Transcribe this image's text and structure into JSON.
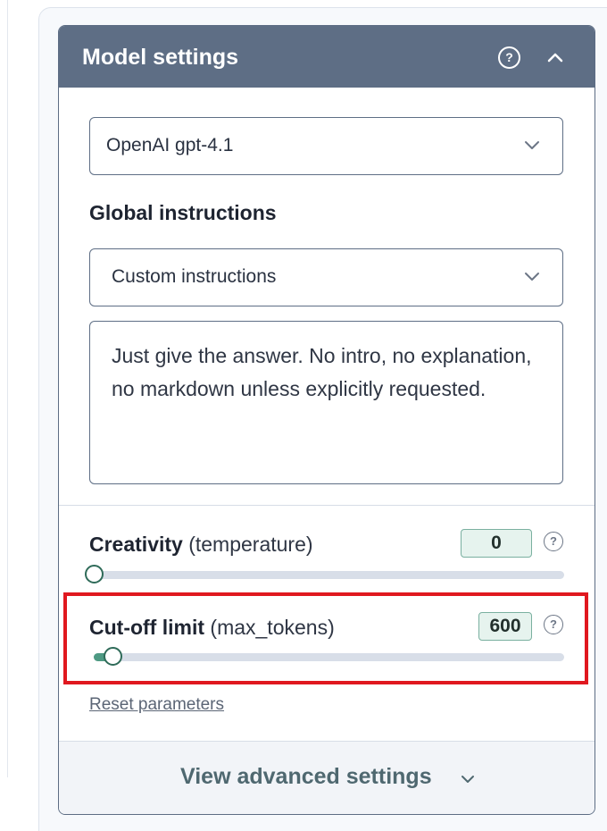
{
  "panel": {
    "title": "Model settings",
    "help_icon": "help-icon",
    "collapse_icon": "chevron-up-icon"
  },
  "model_select": {
    "value": "OpenAI gpt-4.1",
    "icon": "chevron-down-icon"
  },
  "global_instructions": {
    "label": "Global instructions",
    "select_value": "Custom instructions",
    "text": "Just give the answer. No intro, no explanation, no markdown unless explicitly requested."
  },
  "parameters": {
    "creativity": {
      "label_strong": "Creativity",
      "label_light": "(temperature)",
      "value": "0",
      "slider_fraction": 0
    },
    "cutoff": {
      "label_strong": "Cut-off limit",
      "label_light": "(max_tokens)",
      "value": "600",
      "slider_fraction": 0.04
    },
    "reset_label": "Reset parameters"
  },
  "advanced": {
    "label": "View advanced settings",
    "icon": "chevron-down-icon"
  },
  "colors": {
    "header_bg": "#5e6e85",
    "accent_green": "#4e9a83",
    "highlight_red": "#e0181f"
  }
}
